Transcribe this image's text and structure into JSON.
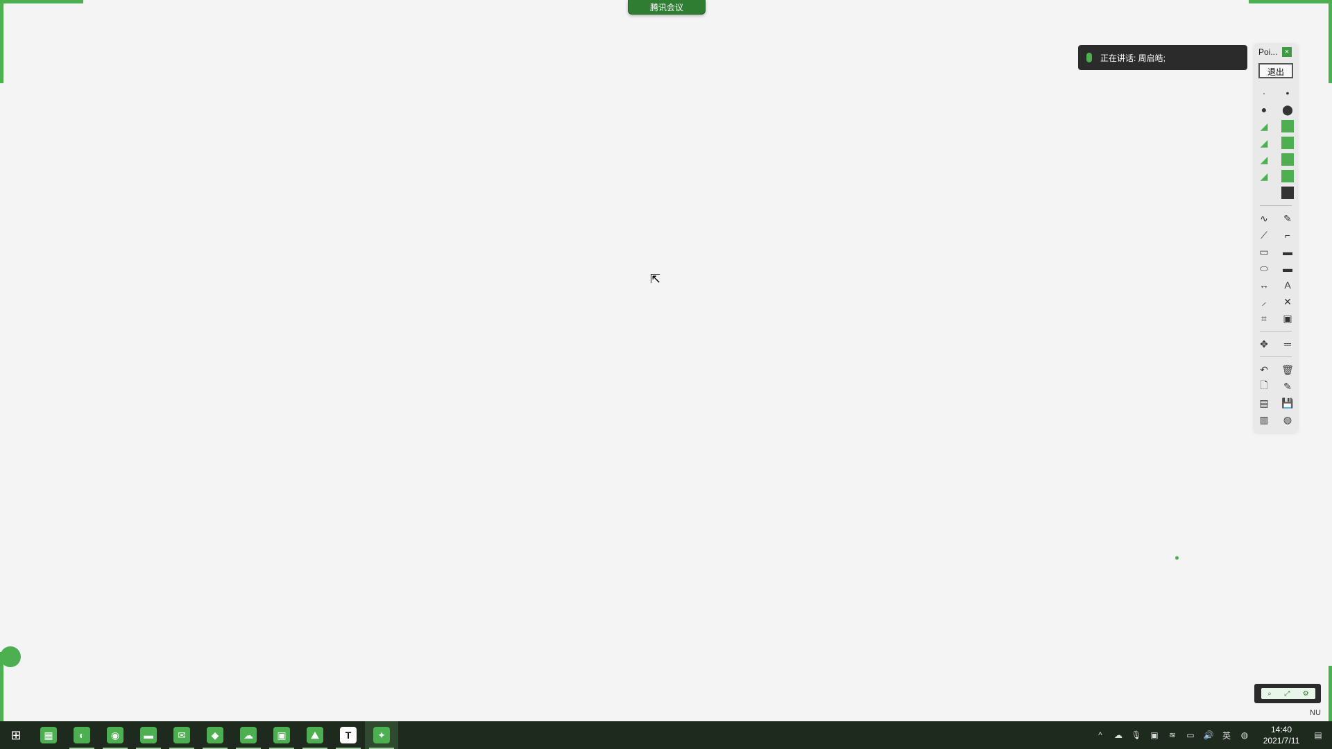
{
  "meeting": {
    "pill_label": "腾讯会议"
  },
  "speaking": {
    "text": "正在讲话: 周启皓;"
  },
  "toolbar": {
    "title": "Poi...",
    "close": "×",
    "exit_label": "退出",
    "rows": [
      [
        "·",
        "•"
      ],
      [
        "●",
        "⬤"
      ],
      [
        "◢",
        "■"
      ],
      [
        "◢",
        "■"
      ],
      [
        "◢",
        "■"
      ],
      [
        "◢",
        "■"
      ],
      [
        "",
        "■"
      ],
      [
        "∿",
        "✎"
      ],
      [
        "⟋",
        "⌐"
      ],
      [
        "▭",
        "▬"
      ],
      [
        "⬭",
        "▬"
      ],
      [
        "↔",
        "A"
      ],
      [
        "⸝",
        "✕"
      ],
      [
        "⌗",
        "▣"
      ],
      [
        "✥",
        "═"
      ],
      [
        "↶",
        "🗑"
      ],
      [
        "🗋",
        "✎"
      ],
      [
        "▤",
        "💾"
      ],
      [
        "▥",
        "◍"
      ]
    ],
    "swatch_colors": [
      "#4caf50",
      "#4caf50",
      "#4caf50",
      "#4caf50",
      "#333333"
    ],
    "mini_ctrl": [
      "⌕",
      "⤢",
      "⚙"
    ],
    "num_label": "NU"
  },
  "taskbar": {
    "start_icon": "windows-icon",
    "apps": [
      {
        "name": "image-viewer-app",
        "glyph": "▦",
        "running": false
      },
      {
        "name": "browser-app",
        "glyph": "◐",
        "running": true
      },
      {
        "name": "chrome-app",
        "glyph": "◉",
        "running": true
      },
      {
        "name": "file-explorer-app",
        "glyph": "▬",
        "running": true
      },
      {
        "name": "mail-app",
        "glyph": "✉",
        "running": true
      },
      {
        "name": "shield-app",
        "glyph": "◆",
        "running": true
      },
      {
        "name": "wechat-app",
        "glyph": "☁",
        "running": true
      },
      {
        "name": "window-app",
        "glyph": "▣",
        "running": true
      },
      {
        "name": "photos-app",
        "glyph": "⛰",
        "running": true
      },
      {
        "name": "typora-app",
        "glyph": "T",
        "running": true
      },
      {
        "name": "meeting-app",
        "glyph": "✦",
        "running": true,
        "active": true
      }
    ],
    "tray": {
      "chevron": "^",
      "ime": "英",
      "time": "14:40",
      "date": "2021/7/11",
      "notification": "▤"
    }
  }
}
